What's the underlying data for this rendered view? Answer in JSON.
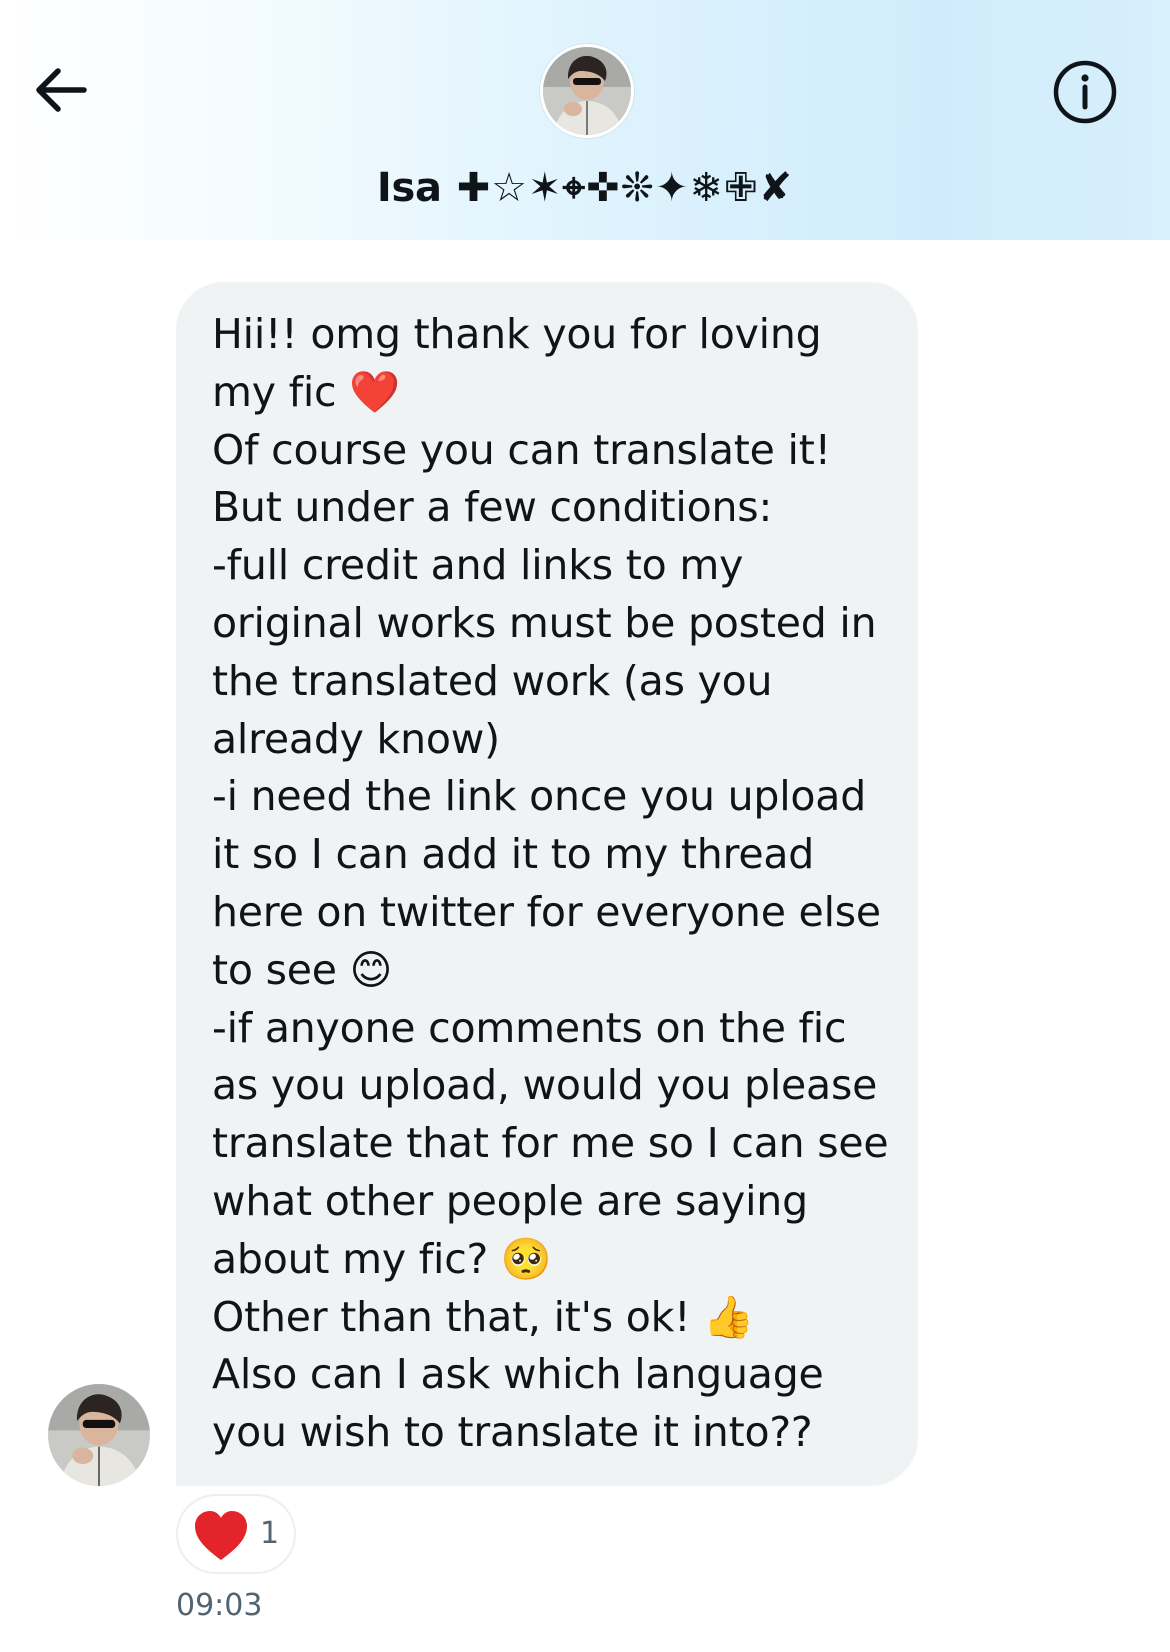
{
  "header": {
    "name": "Isa",
    "name_symbols": " ✚☆✶⌖✜❊✦❄✙✘",
    "back_icon": "arrow-left-icon",
    "info_icon": "info-circle-icon"
  },
  "message": {
    "text": "Hii!! omg thank you for loving my fic ❤️\nOf course you can translate it!\nBut under a few conditions:\n-full credit and links to my original works must be posted in the translated work (as you already know)\n-i need the link once you upload it so I can add it to my thread here on twitter for everyone else to see 😊\n-if anyone comments on the fic as you upload, would you please translate that for me so I can see what other people are saying about my fic? 🥺\nOther than that, it's ok! 👍\nAlso can I ask which language you wish to translate it into??",
    "reaction": {
      "icon": "heart-icon",
      "count": "1"
    },
    "time": "09:03"
  },
  "colors": {
    "bubble": "#eff3f4",
    "text": "#0f1419",
    "muted": "#536471",
    "heart": "#f91880",
    "header_tint": "#d0ecfc"
  }
}
